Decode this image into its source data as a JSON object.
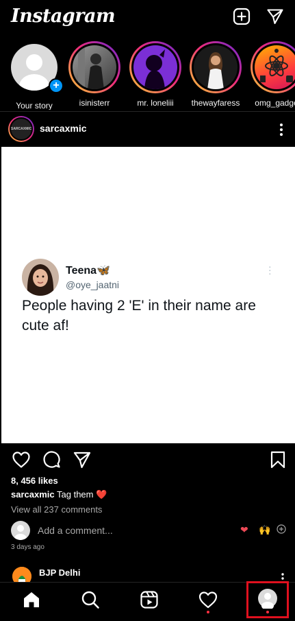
{
  "app": {
    "logo": "Instagram"
  },
  "stories": [
    {
      "label": "Your story"
    },
    {
      "label": "isinisterr"
    },
    {
      "label": "mr. loneliii"
    },
    {
      "label": "thewayfaress"
    },
    {
      "label": "omg_gadge"
    }
  ],
  "post": {
    "username": "sarcaxmic",
    "avatar_text": "SARCAXMIC",
    "tweet": {
      "name": "Teena",
      "handle": "@oye_jaatni",
      "text": "People having 2 'E' in their name are cute af!"
    },
    "likes": "8, 456 likes",
    "caption_user": "sarcaxmic",
    "caption_text": "Tag them",
    "view_comments": "View all 237 comments",
    "add_comment_placeholder": "Add a comment...",
    "time_ago": "3 days ago"
  },
  "next_post": {
    "username": "BJP Delhi"
  },
  "colors": {
    "background": "#000000",
    "accent_blue": "#0095f6",
    "notification_red": "#ff3040",
    "highlight_red": "#e0101e"
  },
  "icons": {
    "top": [
      "new-post-icon",
      "direct-message-icon"
    ],
    "actions": [
      "like-icon",
      "comment-icon",
      "share-icon",
      "save-icon"
    ],
    "nav": [
      "home-icon",
      "search-icon",
      "reels-icon",
      "activity-icon",
      "profile-icon"
    ]
  }
}
